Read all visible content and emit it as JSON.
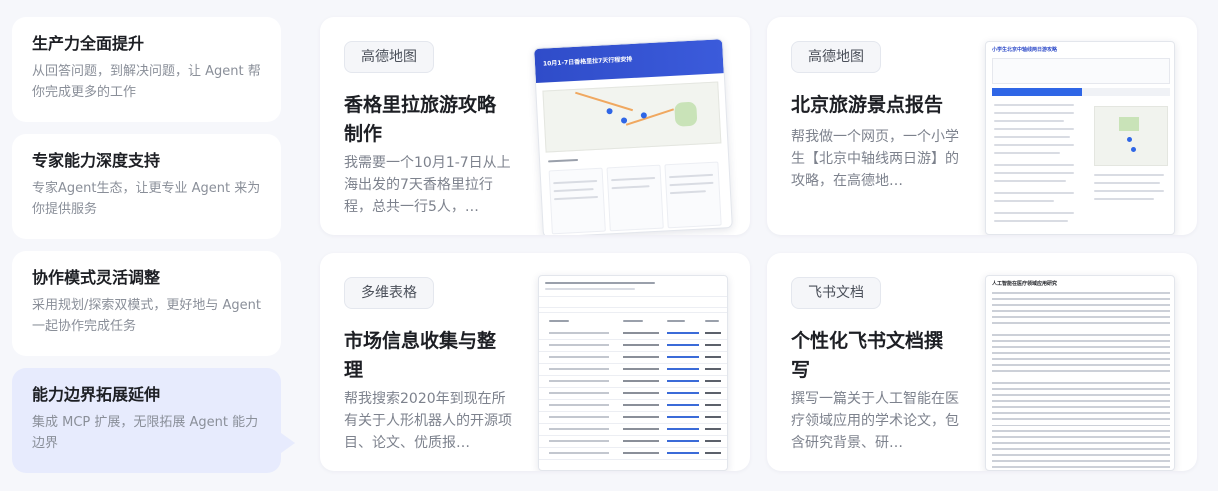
{
  "features": [
    {
      "title": "生产力全面提升",
      "desc": "从回答问题，到解决问题，让 Agent 帮你完成更多的工作"
    },
    {
      "title": "专家能力深度支持",
      "desc": "专家Agent生态，让更专业 Agent 来为你提供服务"
    },
    {
      "title": "协作模式灵活调整",
      "desc": "采用规划/探索双模式，更好地与 Agent 一起协作完成任务"
    },
    {
      "title": "能力边界拓展延伸",
      "desc": "集成 MCP 扩展，无限拓展 Agent 能力边界"
    }
  ],
  "active_feature": 3,
  "cards": [
    {
      "tag": "高德地图",
      "title": "香格里拉旅游攻略制作",
      "desc": "我需要一个10月1-7日从上海出发的7天香格里拉行程，总共一行5人，…",
      "thumb_title": "10月1-7日香格里拉7天行程安排"
    },
    {
      "tag": "高德地图",
      "title": "北京旅游景点报告",
      "desc": "帮我做一个网页，一个小学生【北京中轴线两日游】的攻略，在高德地…",
      "thumb_title": "小学生北京中轴线两日游攻略"
    },
    {
      "tag": "多维表格",
      "title": "市场信息收集与整理",
      "desc": "帮我搜索2020年到现在所有关于人形机器人的开源项目、论文、优质报…",
      "thumb_title": ""
    },
    {
      "tag": "飞书文档",
      "title": "个性化飞书文档撰写",
      "desc": "撰写一篇关于人工智能在医疗领域应用的学术论文，包含研究背景、研…",
      "thumb_title": "人工智能在医疗领域应用研究"
    }
  ],
  "colors": {
    "accent": "#2f4cc9",
    "active_bg": "#e7ebfd",
    "page_bg": "#f6f7fb"
  }
}
